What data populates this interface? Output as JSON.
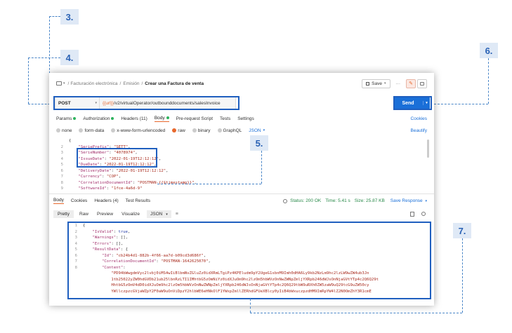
{
  "callouts": [
    "3.",
    "4.",
    "5.",
    "6.",
    "7."
  ],
  "header": {
    "breadcrumb": [
      "Facturación electrónica",
      "Emisión"
    ],
    "title": "Crear una Factura de venta",
    "save_label": "Save",
    "more_label": "···"
  },
  "request": {
    "method": "POST",
    "url_var": "{{url}}",
    "url_path": "/v2/virtualOperator/outbounddocuments/salesInvoice",
    "send_label": "Send"
  },
  "req_tabs": {
    "params": "Params",
    "authorization": "Authorization",
    "headers": "Headers (11)",
    "body": "Body",
    "prescript": "Pre-request Script",
    "tests": "Tests",
    "settings": "Settings",
    "cookies": "Cookies"
  },
  "body_types": {
    "none": "none",
    "formdata": "form-data",
    "urlencoded": "x-www-form-urlencoded",
    "raw": "raw",
    "binary": "binary",
    "graphql": "GraphQL",
    "json": "JSON",
    "beautify": "Beautify"
  },
  "req_code": [
    {
      "n": "",
      "t": "{"
    },
    {
      "n": "2",
      "t": "    \"SeriePrefix\": \"SETT\","
    },
    {
      "n": "3",
      "t": "    \"SerieNumber\": \"4078974\","
    },
    {
      "n": "4",
      "t": "    \"IssueDate\": \"2022-01-19T12:12:12\","
    },
    {
      "n": "5",
      "t": "    \"DueDate\": \"2022-01-19T12:12:12\","
    },
    {
      "n": "6",
      "t": "    \"DeliveryDate\": \"2022-01-19T12:12:12\","
    },
    {
      "n": "7",
      "t": "    \"Currency\": \"COP\","
    },
    {
      "n": "8",
      "t": "    \"CorrelationDocumentId\": \"POSTMAN-{{$timestamp}}\","
    },
    {
      "n": "9",
      "t": "    \"SoftwareId\": \"1fce-4a6d-9\""
    }
  ],
  "resp_tabs": {
    "body": "Body",
    "cookies": "Cookies",
    "headers": "Headers (4)",
    "test_results": "Test Results",
    "status": "Status: 200 OK",
    "time": "Time: 5.41 s",
    "size": "Size: 25.87 KB",
    "save_response": "Save Response"
  },
  "resp_view": {
    "pretty": "Pretty",
    "raw": "Raw",
    "preview": "Preview",
    "visualize": "Visualize",
    "json": "JSON"
  },
  "resp_code": [
    {
      "n": "1",
      "t": "{"
    },
    {
      "n": "2",
      "t": "    \"IsValid\": true,"
    },
    {
      "n": "3",
      "t": "    \"Warnings\": [],"
    },
    {
      "n": "4",
      "t": "    \"Errors\": [],"
    },
    {
      "n": "5",
      "t": "    \"ResultData\": {"
    },
    {
      "n": "6",
      "t": "        \"Id\": \"cb24b4d1-882b-4f66-aa7d-b09cd3d686f\","
    },
    {
      "n": "7",
      "t": "        \"CorrelationDocumentId\": \"POSTMAN-1642625070\","
    },
    {
      "n": "8",
      "t": "        \"Content\":"
    },
    {
      "n": "",
      "t": "            \"PD94bWwgdmVyc2lvbj0iMS4wIiBlbmNvZGluZz0idXRmLTgiPz4KPEludm9pY2UgeG1sbnM9Imh0dHA6Ly9kb2NzLm9hc2lzLW9wZW4ub3Jn"
    },
    {
      "n": "",
      "t": "            1tb25022yZW0hdGVDb21ub25lbnRzLTI1IMhtbG5zOmNiYz0idXJuOm9hc2lzOm5hbWVzOnNwZWNpZmljYXRpb246dWJsOnNjaGVtYTp4c2Q6Q29t"
    },
    {
      "n": "",
      "t": "            HhtbG5zOmV4dD0idXJuOm9hc2lzOm5hbWVzOnNwZWNpZmljYXRpb246dWJsOnNjaGVtYTp4c2Q6Q29tbW9uRXh0ZW5zaW9uQ29tcG9uZW50cy"
    },
    {
      "n": "",
      "t": "            YWllczpzcGVjaWZpY2F0aW9uOnViDpzY2hlbWE6eHNkOlF1YWxpZmllZERhdGFUeXBlcy0yIiB4bWxuczpzdHM9ImRpYW4lZ2N0OmZhY3R1cmE"
    }
  ]
}
